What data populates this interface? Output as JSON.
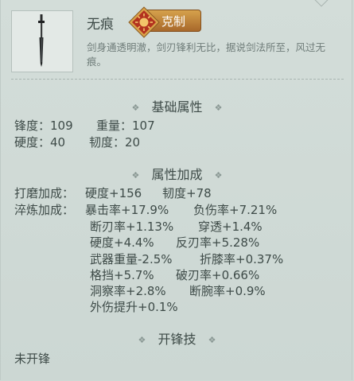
{
  "item": {
    "name": "无痕",
    "counter_tag": "克制",
    "description": "剑身通透明澈，剑刃锋利无比，据说剑法所至，风过无痕。"
  },
  "sections": {
    "basic": {
      "title": "基础属性",
      "sharpness": "锋度：109",
      "weight": "重量：107",
      "hardness": "硬度：40",
      "toughness": "韧度：20"
    },
    "bonus": {
      "title": "属性加成",
      "polish_label": "打磨加成：",
      "polish_1": "硬度+156",
      "polish_2": "韧度+78",
      "temper_label": "淬炼加成：",
      "temper_rows": [
        [
          "暴击率+17.9%",
          "负伤率+7.21%"
        ],
        [
          "断刃率+1.13%",
          "穿透+1.4%"
        ],
        [
          "硬度+4.4%",
          "反刃率+5.28%"
        ],
        [
          "武器重量-2.5%",
          "折膝率+0.37%"
        ],
        [
          "格挡+5.7%",
          "破刃率+0.66%"
        ],
        [
          "洞察率+2.8%",
          "断腕率+0.9%"
        ],
        [
          "外伤提升+0.1%",
          ""
        ]
      ]
    },
    "edge": {
      "title": "开锋技",
      "status": "未开锋"
    }
  },
  "decorations": {
    "diamond": "❖"
  },
  "colors": {
    "panel_bg": "#cfd9d5",
    "text": "#3e4b48",
    "muted_text": "#6f7c79",
    "badge_gold": "#c98c3c",
    "badge_emblem": "#b3331f"
  }
}
